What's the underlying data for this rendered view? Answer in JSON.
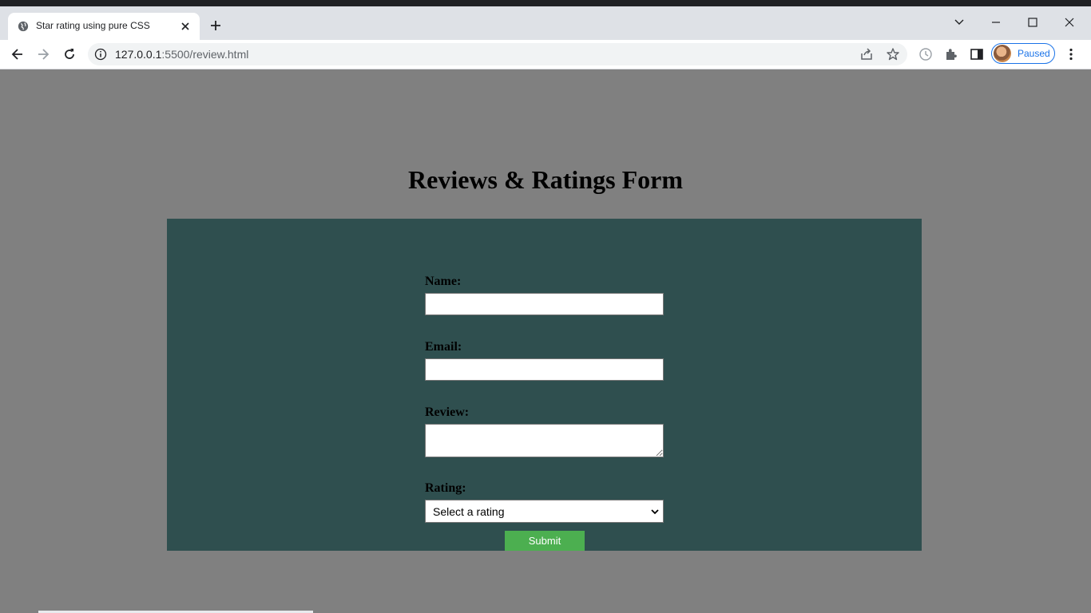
{
  "browser": {
    "tab_title": "Star rating using pure CSS",
    "url_host": "127.0.0.1",
    "url_path": ":5500/review.html",
    "profile_label": "Paused"
  },
  "page": {
    "title": "Reviews & Ratings Form",
    "background": "#808080",
    "panel_color": "#2f4f4f"
  },
  "form": {
    "name_label": "Name:",
    "name_value": "",
    "email_label": "Email:",
    "email_value": "",
    "review_label": "Review:",
    "review_value": "",
    "rating_label": "Rating:",
    "rating_selected": "Select a rating",
    "submit_label": "Submit",
    "submit_color": "#4caf50"
  }
}
